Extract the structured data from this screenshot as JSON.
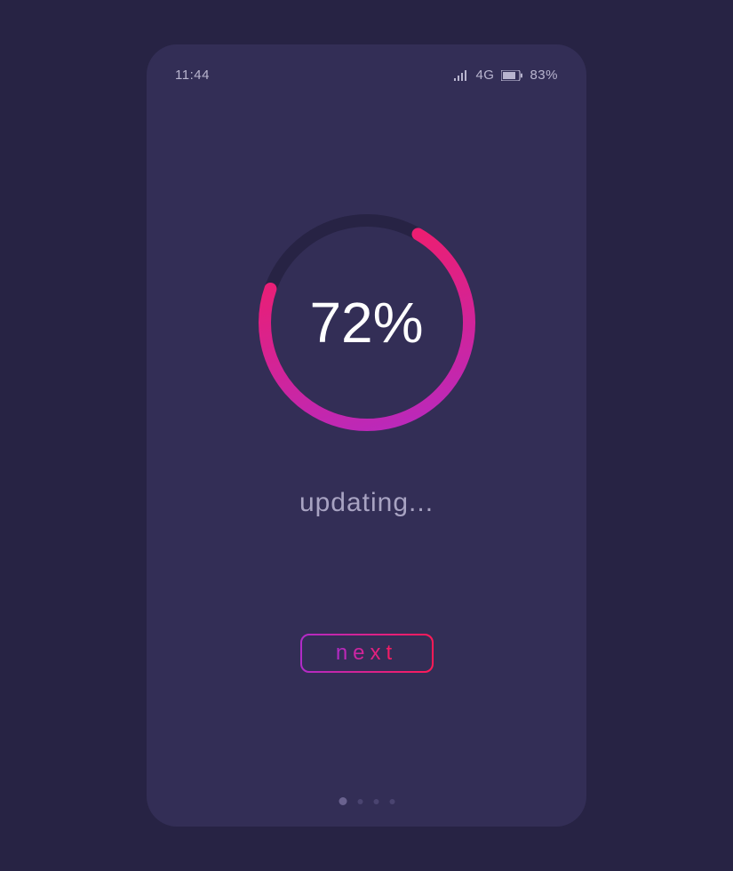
{
  "status_bar": {
    "time": "11:44",
    "network_label": "4G",
    "battery_percent": "83%"
  },
  "progress": {
    "value": 72,
    "display": "72%"
  },
  "status_text": "updating...",
  "next_button_label": "next",
  "page_indicator": {
    "count": 4,
    "active_index": 0
  },
  "colors": {
    "bg_outer": "#272344",
    "bg_phone": "#332e56",
    "track": "#272344",
    "grad_start": "#b12bc8",
    "grad_end": "#ff1a56"
  }
}
